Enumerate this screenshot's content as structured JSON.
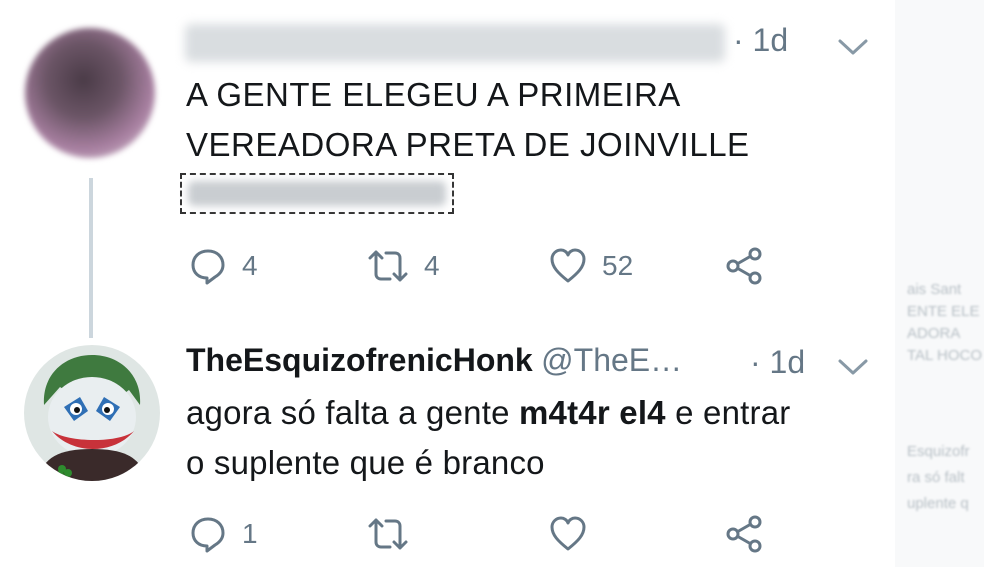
{
  "tweet1": {
    "time": "1d",
    "text_line1": "A GENTE ELEGEU A PRIMEIRA",
    "text_line2": "VEREADORA PRETA DE JOINVILLE",
    "actions": {
      "reply_count": "4",
      "retweet_count": "4",
      "like_count": "52"
    }
  },
  "tweet2": {
    "display_name": "TheEsquizofrenicHonk",
    "handle": "@TheE…",
    "time": "1d",
    "text_line1_a": "agora só falta a gente ",
    "text_line1_b": "m4t4r el4",
    "text_line1_c": " e entrar",
    "text_line2": "o suplente que é branco",
    "actions": {
      "reply_count": "1"
    }
  },
  "side_panel": {
    "lines": [
      "ais Sant",
      "ENTE ELE",
      "ADORA",
      "TAL HOCO",
      "Esquizofr",
      "ra só falt",
      "uplente q"
    ]
  },
  "colors": {
    "text": "#14171a",
    "secondary": "#657786",
    "thread_line": "#ccd6dd"
  }
}
